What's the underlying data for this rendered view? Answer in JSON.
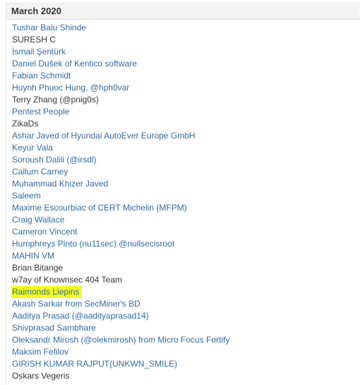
{
  "section": {
    "title": "March 2020"
  },
  "theme": {
    "link_color": "#2f6ba3",
    "text_color": "#333333",
    "highlight_color": "#f5ff1a"
  },
  "entries": [
    {
      "name": "Tushar Balu Shinde",
      "type": "link"
    },
    {
      "name": "SURESH C",
      "type": "text"
    },
    {
      "name": "İsmail Şentürk",
      "type": "link"
    },
    {
      "name": "Daniel Dušek of Kentico software",
      "type": "link"
    },
    {
      "name": "Fabian Schmidt",
      "type": "link"
    },
    {
      "name": "Huynh Phuoc Hung, @hph0var",
      "type": "link"
    },
    {
      "name": "Terry Zhang (@pnig0s)",
      "type": "text"
    },
    {
      "name": "Pentest People",
      "type": "link"
    },
    {
      "name": "ZikaDs",
      "type": "text"
    },
    {
      "name": "Ashar Javed of Hyundai AutoEver Europe GmbH",
      "type": "link"
    },
    {
      "name": "Keyur Vala",
      "type": "link"
    },
    {
      "name": "Soroush Dalili (@irsdl)",
      "type": "link"
    },
    {
      "name": "Callum Carney",
      "type": "link"
    },
    {
      "name": "Muhammad Khizer Javed",
      "type": "link"
    },
    {
      "name": "Saleem",
      "type": "link"
    },
    {
      "name": "Maxime Escourbiac of CERT Michelin (MFPM)",
      "type": "link"
    },
    {
      "name": "Craig Wallace",
      "type": "link"
    },
    {
      "name": "Cameron Vincent",
      "type": "link"
    },
    {
      "name": "Humphreys Pinto (nu11sec) @nullsecisroot",
      "type": "link"
    },
    {
      "name": "MAHIN VM",
      "type": "link"
    },
    {
      "name": "Brian Bitange",
      "type": "text"
    },
    {
      "name": "w7ay of Knownsec 404 Team",
      "type": "text"
    },
    {
      "name": "Raimonds Liepins",
      "type": "link",
      "highlighted": true
    },
    {
      "name": "Akash Sarkar from SecMiner's BD",
      "type": "link"
    },
    {
      "name": "Aaditya Prasad (@aadityaprasad14)",
      "type": "link"
    },
    {
      "name": "Shivprasad Sambhare",
      "type": "link"
    },
    {
      "name": "Oleksandr Mirosh (@olekmirosh) from Micro Focus Fortify",
      "type": "link"
    },
    {
      "name": "Maksim Fefilov",
      "type": "link"
    },
    {
      "name": "GIRISH KUMAR RAJPUT(UNKWN_SMILE)",
      "type": "link"
    },
    {
      "name": "Oskars Vegeris",
      "type": "text"
    }
  ]
}
